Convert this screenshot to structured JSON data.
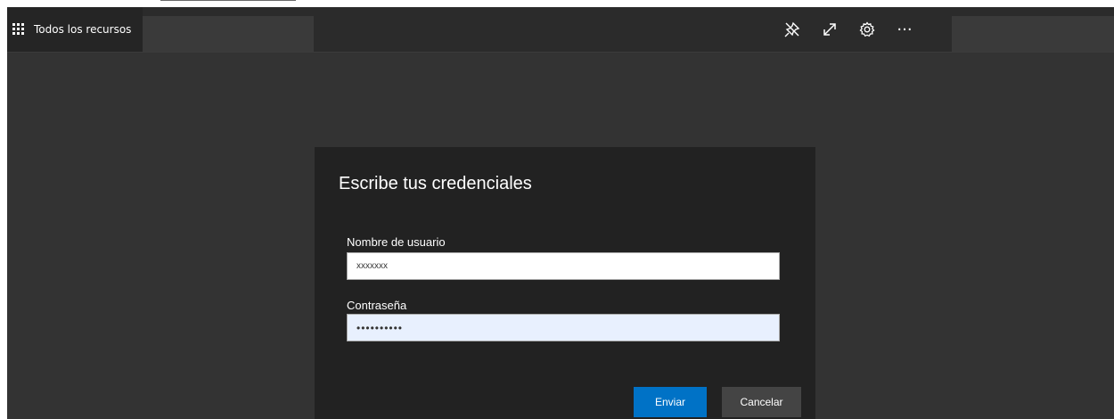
{
  "header": {
    "menu_icon": "waffle-grid-icon",
    "resources_label": "Todos los recursos",
    "toolbar": {
      "icons": [
        "pin-icon",
        "expand-icon",
        "settings-icon",
        "more-icon"
      ],
      "more_glyph": "···"
    }
  },
  "dialog": {
    "title": "Escribe tus credenciales",
    "username_label": "Nombre de usuario",
    "username_value": "xxxxxxx",
    "password_label": "Contraseña",
    "password_value": "••••••••••",
    "submit_label": "Enviar",
    "cancel_label": "Cancelar"
  },
  "colors": {
    "background": "#333333",
    "topbar": "#2b2b2b",
    "dialog": "#222222",
    "primary_button": "#0072c6",
    "secondary_button": "#444444",
    "autofill_input": "#e8f0fe"
  }
}
